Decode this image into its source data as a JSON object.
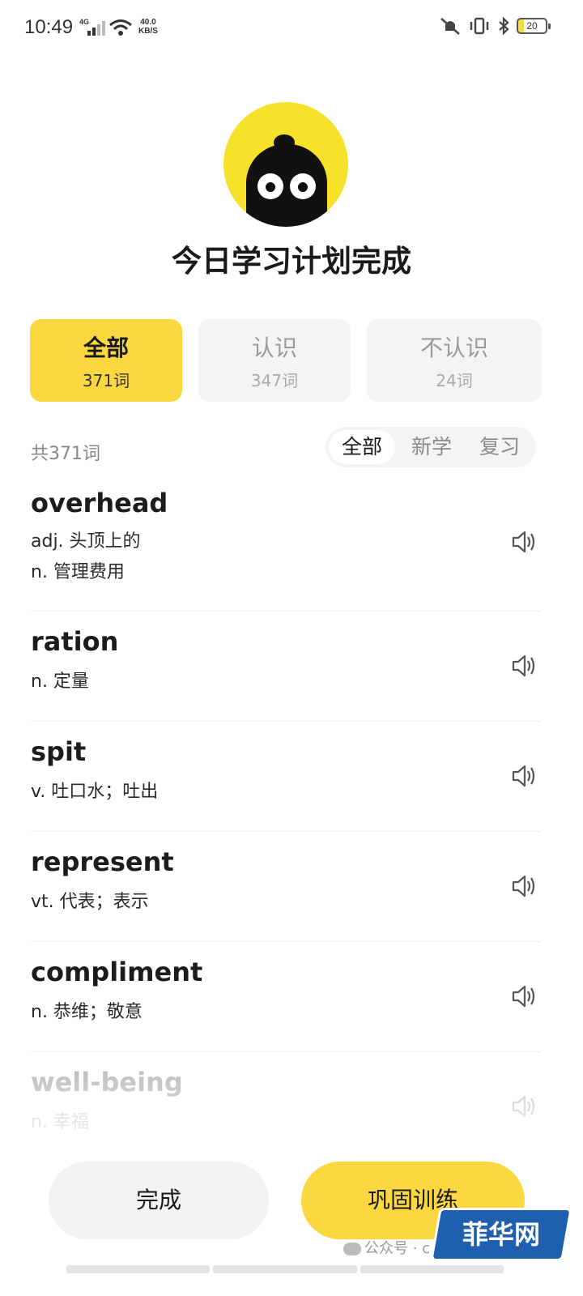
{
  "status_bar": {
    "time": "10:49",
    "network": "4G",
    "speed_value": "40.0",
    "speed_unit": "KB/S",
    "battery": "20",
    "icons": [
      "signal-icon",
      "wifi-icon",
      "mute-icon",
      "vibrate-icon",
      "bluetooth-icon",
      "battery-icon"
    ]
  },
  "header": {
    "title": "今日学习计划完成"
  },
  "filters": [
    {
      "label": "全部",
      "count": "371词",
      "active": true
    },
    {
      "label": "认识",
      "count": "347词",
      "active": false
    },
    {
      "label": "不认识",
      "count": "24词",
      "active": false
    }
  ],
  "list_header": {
    "total": "共371词",
    "segments": [
      "全部",
      "新学",
      "复习"
    ],
    "active_segment": "全部"
  },
  "words": [
    {
      "term": "overhead",
      "definitions": [
        "adj. 头顶上的",
        "n. 管理费用"
      ]
    },
    {
      "term": "ration",
      "definitions": [
        "n. 定量"
      ]
    },
    {
      "term": "spit",
      "definitions": [
        "v. 吐口水；吐出"
      ]
    },
    {
      "term": "represent",
      "definitions": [
        "vt. 代表；表示"
      ]
    },
    {
      "term": "compliment",
      "definitions": [
        "n. 恭维；敬意"
      ]
    },
    {
      "term": "well-being",
      "definitions": [
        "n. 幸福"
      ]
    }
  ],
  "actions": {
    "done": "完成",
    "train": "巩固训练"
  },
  "footer": {
    "source": "公众号 · c"
  },
  "watermark": {
    "text": "菲华网"
  },
  "colors": {
    "accent": "#fcd840",
    "mascot": "#f7e12a",
    "muted_bg": "#f4f4f4",
    "watermark_bg": "#1f5fb0"
  }
}
